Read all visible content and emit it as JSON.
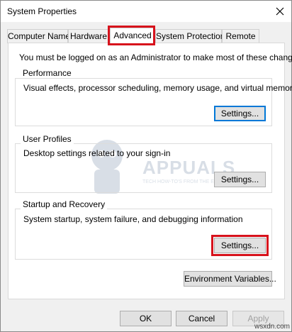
{
  "window": {
    "title": "System Properties"
  },
  "tabs": [
    {
      "label": "Computer Name"
    },
    {
      "label": "Hardware"
    },
    {
      "label": "Advanced"
    },
    {
      "label": "System Protection"
    },
    {
      "label": "Remote"
    }
  ],
  "active_tab": "Advanced",
  "intro": "You must be logged on as an Administrator to make most of these changes.",
  "groups": {
    "performance": {
      "title": "Performance",
      "description": "Visual effects, processor scheduling, memory usage, and virtual memory",
      "button": "Settings..."
    },
    "user_profiles": {
      "title": "User Profiles",
      "description": "Desktop settings related to your sign-in",
      "button": "Settings..."
    },
    "startup_recovery": {
      "title": "Startup and Recovery",
      "description": "System startup, system failure, and debugging information",
      "button": "Settings..."
    }
  },
  "environment_button": "Environment Variables...",
  "footer": {
    "ok": "OK",
    "cancel": "Cancel",
    "apply": "Apply"
  },
  "watermark": {
    "brand": "APPUALS",
    "tagline": "TECH HOW-TO'S FROM THE EXPERTS!",
    "site": "wsxdn.com"
  },
  "colors": {
    "highlight": "#d7121c",
    "focus": "#0078d7"
  }
}
